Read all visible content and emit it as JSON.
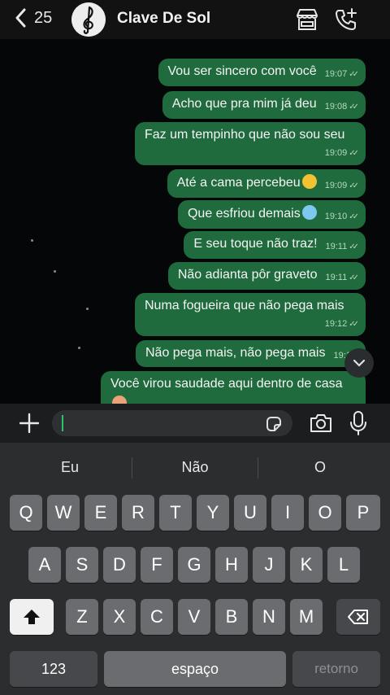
{
  "header": {
    "back_count": "25",
    "contact_name": "Clave De Sol",
    "icons": [
      "chevron-left-icon",
      "treble-clef-avatar",
      "store-icon",
      "phone-add-icon"
    ]
  },
  "messages": [
    {
      "text": "Vou ser sincero com você",
      "time": "19:07"
    },
    {
      "text": "Acho que pra mim já deu",
      "time": "19:08"
    },
    {
      "text": "Faz um tempinho que não sou seu",
      "time": "19:09"
    },
    {
      "text": "Até a cama percebeu",
      "time": "19:09",
      "emoji": "confused-face"
    },
    {
      "text": "Que esfriou demais",
      "time": "19:10",
      "emoji": "cold-face"
    },
    {
      "text": "E seu toque não traz!",
      "time": "19:11"
    },
    {
      "text": "Não adianta pôr graveto",
      "time": "19:11"
    },
    {
      "text": "Numa fogueira que não pega mais",
      "time": "19:12"
    },
    {
      "text": "Não pega mais, não pega mais",
      "time": "19:13"
    },
    {
      "text": "Você virou saudade aqui dentro de casa",
      "time": ""
    }
  ],
  "composer": {
    "input_value": ""
  },
  "keyboard": {
    "suggestions": [
      "Eu",
      "Não",
      "O"
    ],
    "row1": [
      "Q",
      "W",
      "E",
      "R",
      "T",
      "Y",
      "U",
      "I",
      "O",
      "P"
    ],
    "row2": [
      "A",
      "S",
      "D",
      "F",
      "G",
      "H",
      "J",
      "K",
      "L"
    ],
    "row3": [
      "Z",
      "X",
      "C",
      "V",
      "B",
      "N",
      "M"
    ],
    "numbers_label": "123",
    "space_label": "espaço",
    "return_label": "retorno"
  },
  "colors": {
    "bubble": "#1f6b3d",
    "accent": "#29c46a",
    "header": "#121212"
  }
}
